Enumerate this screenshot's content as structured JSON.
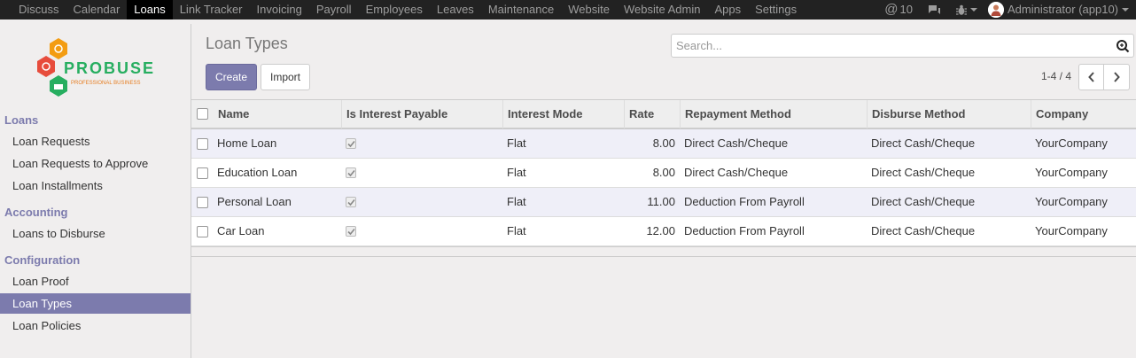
{
  "topbar": {
    "menu": [
      "Discuss",
      "Calendar",
      "Loans",
      "Link Tracker",
      "Invoicing",
      "Payroll",
      "Employees",
      "Leaves",
      "Maintenance",
      "Website",
      "Website Admin",
      "Apps",
      "Settings"
    ],
    "active_index": 2,
    "mentions_count": "10",
    "user_label": "Administrator (app10)"
  },
  "logo": {
    "name": "PROBUSE",
    "tagline": "PROFESSIONAL BUSINESS"
  },
  "sidebar": {
    "sections": [
      {
        "title": "Loans",
        "items": [
          "Loan Requests",
          "Loan Requests to Approve",
          "Loan Installments"
        ]
      },
      {
        "title": "Accounting",
        "items": [
          "Loans to Disburse"
        ]
      },
      {
        "title": "Configuration",
        "items": [
          "Loan Proof",
          "Loan Types",
          "Loan Policies"
        ]
      }
    ],
    "active_item": "Loan Types"
  },
  "page": {
    "title": "Loan Types",
    "search_placeholder": "Search...",
    "create_label": "Create",
    "import_label": "Import",
    "pager": "1-4 / 4"
  },
  "table": {
    "columns": [
      "Name",
      "Is Interest Payable",
      "Interest Mode",
      "Rate",
      "Repayment Method",
      "Disburse Method",
      "Company"
    ],
    "rows": [
      {
        "name": "Home Loan",
        "interest_payable": true,
        "mode": "Flat",
        "rate": "8.00",
        "repayment": "Direct Cash/Cheque",
        "disburse": "Direct Cash/Cheque",
        "company": "YourCompany"
      },
      {
        "name": "Education Loan",
        "interest_payable": true,
        "mode": "Flat",
        "rate": "8.00",
        "repayment": "Direct Cash/Cheque",
        "disburse": "Direct Cash/Cheque",
        "company": "YourCompany"
      },
      {
        "name": "Personal Loan",
        "interest_payable": true,
        "mode": "Flat",
        "rate": "11.00",
        "repayment": "Deduction From Payroll",
        "disburse": "Direct Cash/Cheque",
        "company": "YourCompany"
      },
      {
        "name": "Car Loan",
        "interest_payable": true,
        "mode": "Flat",
        "rate": "12.00",
        "repayment": "Deduction From Payroll",
        "disburse": "Direct Cash/Cheque",
        "company": "YourCompany"
      }
    ]
  },
  "colors": {
    "accent": "#7c7bad",
    "topbar": "#222222"
  }
}
